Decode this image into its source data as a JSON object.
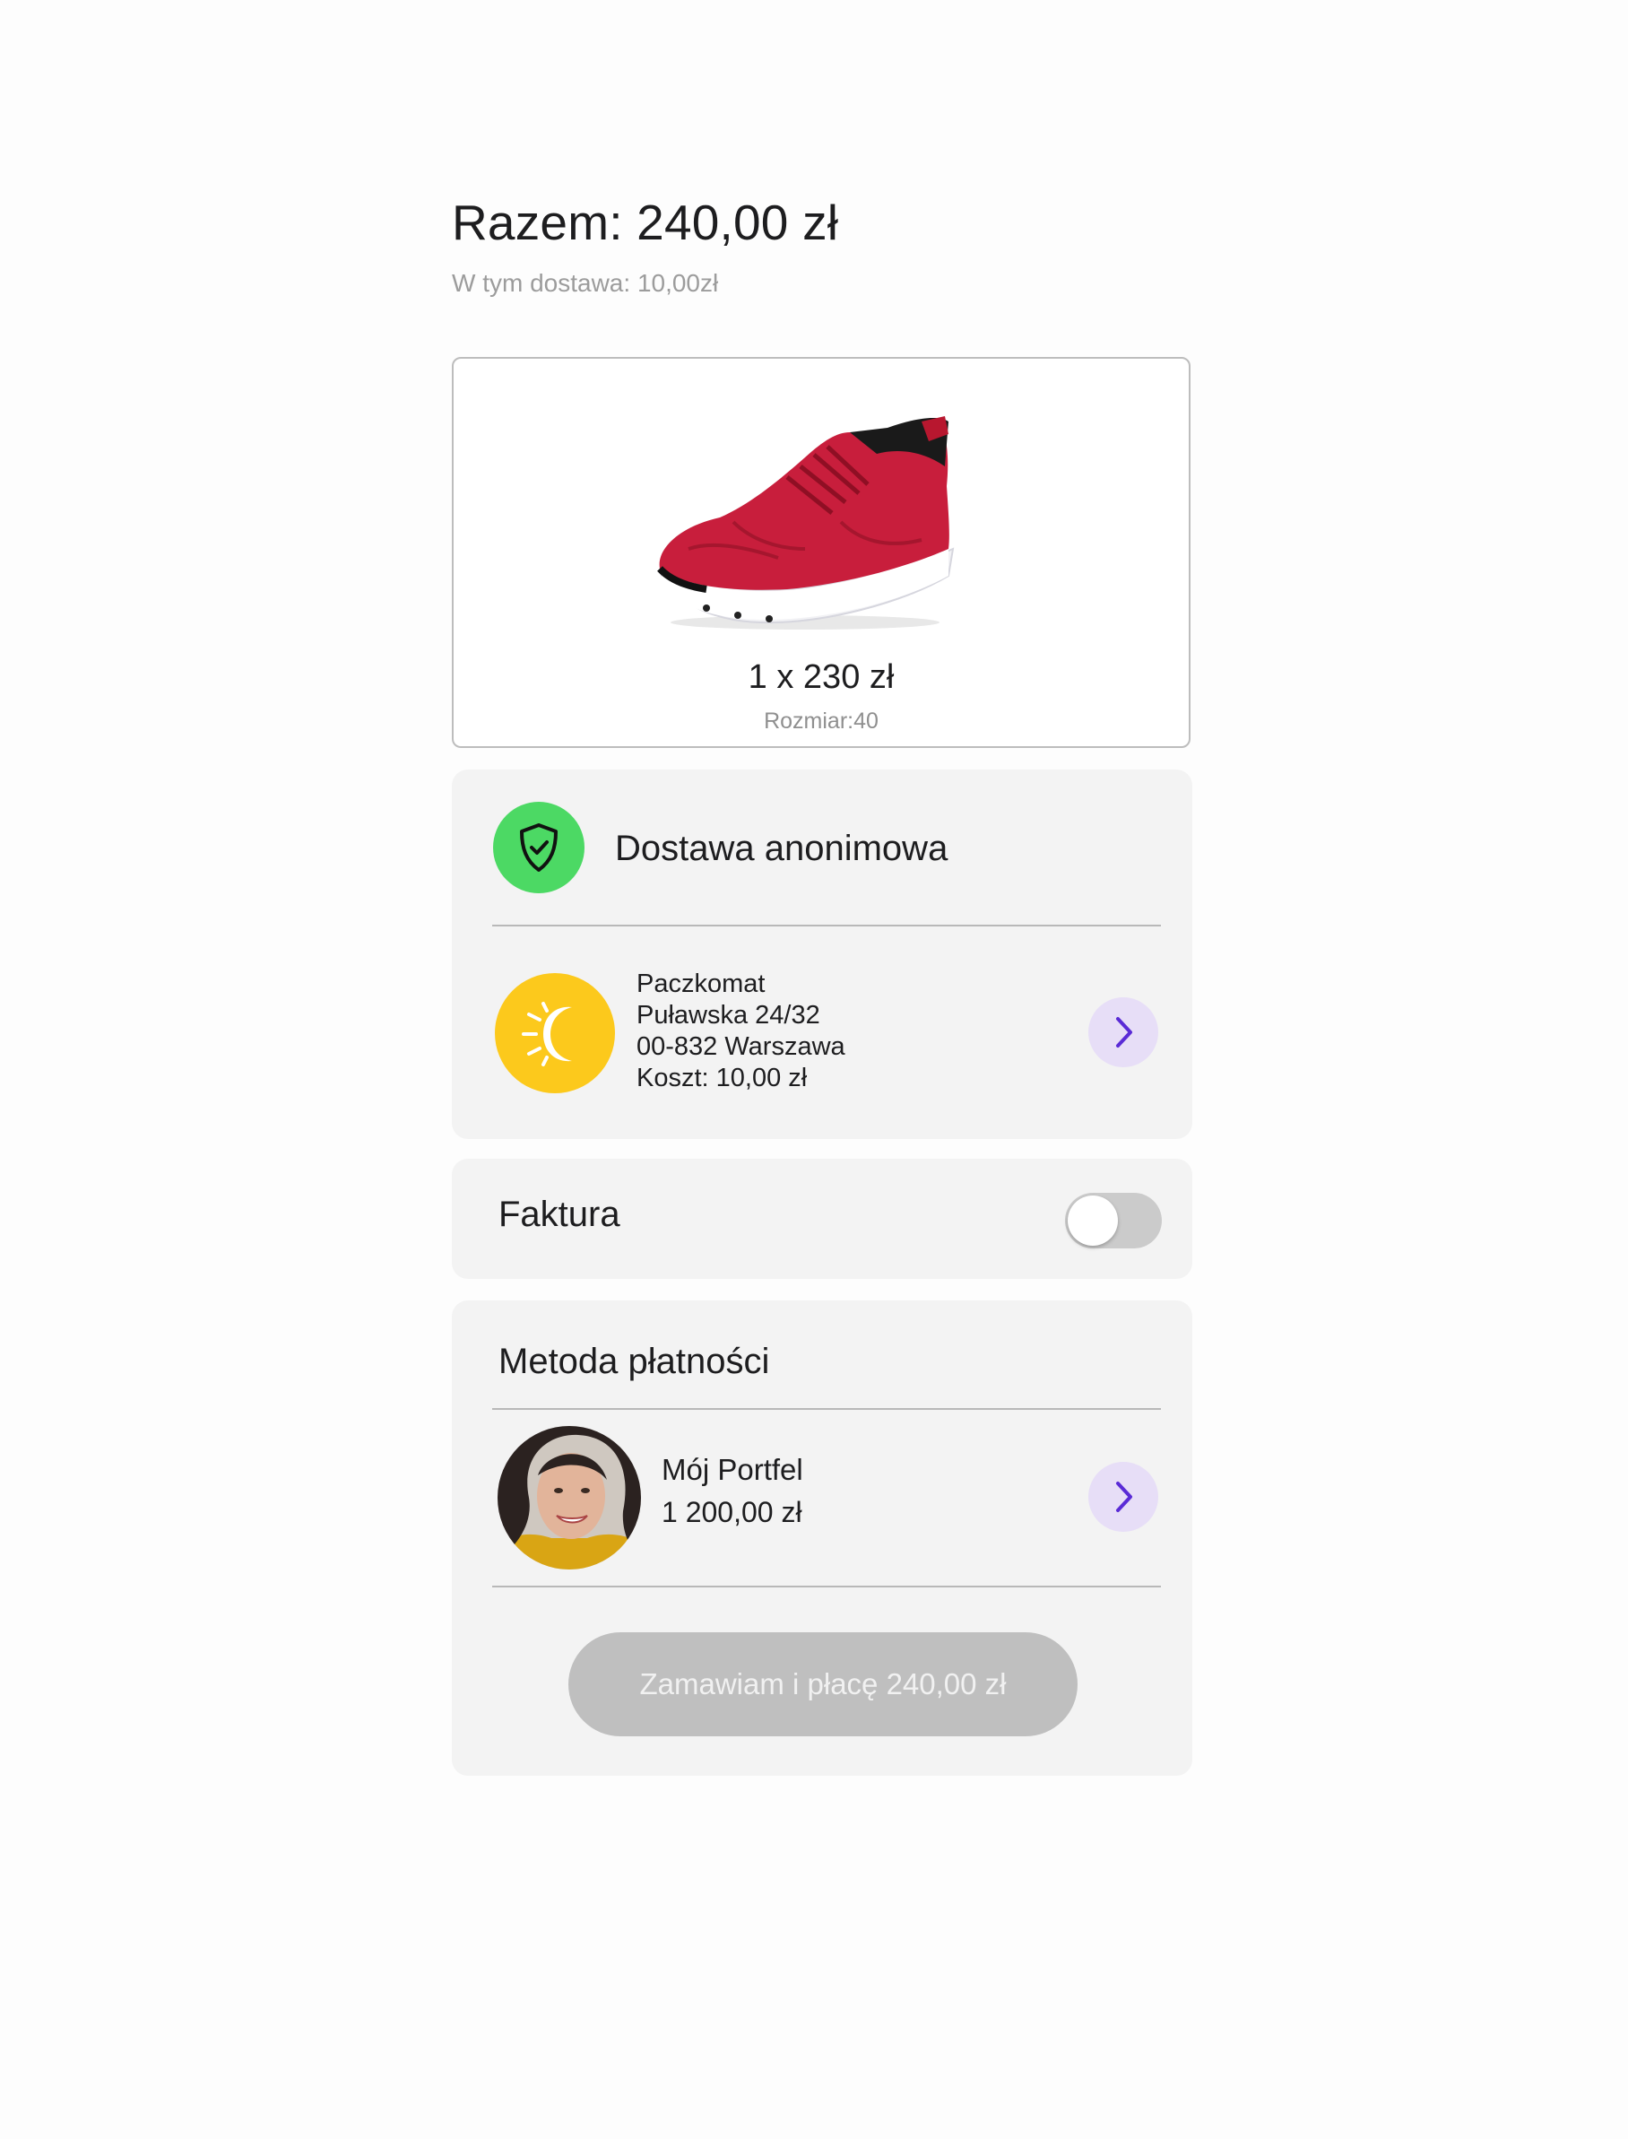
{
  "summary": {
    "total": "Razem: 240,00 zł",
    "delivery_note": "W tym dostawa: 10,00zł"
  },
  "product": {
    "qty_price": "1 x 230 zł",
    "size": "Rozmiar:40",
    "image_icon": "red-sneaker-image"
  },
  "delivery": {
    "anonymous_label": "Dostawa anonimowa",
    "anonymous_icon": "shield-check-icon",
    "locker_icon": "sun-icon",
    "locker": {
      "title": "Paczkomat",
      "street": "Puławska 24/32",
      "city": "00-832 Warszawa",
      "cost": "Koszt: 10,00 zł"
    }
  },
  "invoice": {
    "label": "Faktura",
    "enabled": false
  },
  "payment": {
    "title": "Metoda płatności",
    "wallet_name": "Mój Portfel",
    "wallet_balance": "1 200,00 zł"
  },
  "order_button": "Zamawiam i płacę 240,00 zł",
  "colors": {
    "shield_bg": "#4cd964",
    "sun_bg": "#fcc91c",
    "chevron_bg": "#e7def7",
    "chevron": "#5a2bd6",
    "button_disabled": "#bfbfbf"
  }
}
